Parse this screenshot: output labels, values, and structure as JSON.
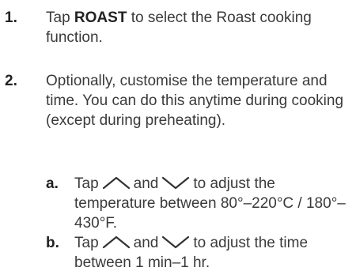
{
  "steps": [
    {
      "number": "1.",
      "before_bold": "Tap ",
      "bold": "ROAST",
      "after_bold": " to select the Roast cooking function."
    },
    {
      "number": "2.",
      "text": "Optionally, customise the temperature and time. You can do this anytime during cooking (except during preheating)."
    }
  ],
  "substeps": [
    {
      "letter": "a.",
      "tap": "Tap",
      "and": "and",
      "rest": "to adjust the temperature between 80°–220°C / 180°–430°F.",
      "icons": [
        "chevron-up-icon",
        "chevron-down-icon"
      ]
    },
    {
      "letter": "b.",
      "tap": "Tap",
      "and": "and",
      "rest": "to adjust the time between 1 min–1 hr.",
      "icons": [
        "chevron-up-icon",
        "chevron-down-icon"
      ]
    }
  ]
}
